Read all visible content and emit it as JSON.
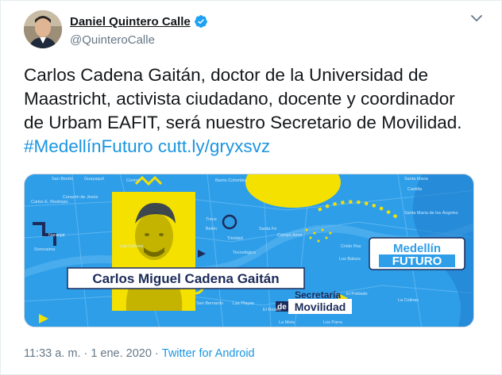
{
  "author": {
    "name": "Daniel Quintero Calle",
    "handle": "@QuinteroCalle",
    "verified": true
  },
  "tweet": {
    "text": "Carlos Cadena Gaitán, doctor de la Universidad de Maastricht, activista ciudadano, docente y coordinador de Urbam EAFIT, será nuestro Secretario de Movilidad.",
    "hashtag": "#MedellínFuturo",
    "link": "cutt.ly/gryxsvz"
  },
  "media": {
    "person_name": "Carlos Miguel Cadena Gaitán",
    "badge_line1": "Secretaría",
    "badge_de": "de",
    "badge_line2": "Movilidad",
    "logo_top": "Medellín",
    "logo_bottom": "FUTURO",
    "map_labels": [
      "San Benito",
      "Guayaquil",
      "Centro",
      "Barrio Colombia",
      "Santa Maria",
      "Carlos E. Restrepo",
      "Corazón de Jesús",
      "Castilla",
      "Trece",
      "Naranjal",
      "Sorocaima",
      "Los Colores",
      "Belén",
      "Trinidad",
      "Tecnológico",
      "Santa Fe",
      "Campo Amor",
      "Cristo Rey",
      "Santa María de los Ángeles",
      "Los Balsos",
      "El Poblado",
      "La Colinas",
      "San Bernardo",
      "Las Playas",
      "El Rodeo",
      "La Mota",
      "Los Parra"
    ],
    "colors": {
      "sky": "#2f9ee8",
      "yellow": "#f5e100",
      "navy": "#1c2b5a"
    }
  },
  "meta": {
    "time": "11:33 a. m.",
    "separator": "·",
    "date": "1 ene. 2020",
    "app": "Twitter for Android"
  },
  "icons": [
    "verified-badge-icon",
    "chevron-down-icon"
  ]
}
